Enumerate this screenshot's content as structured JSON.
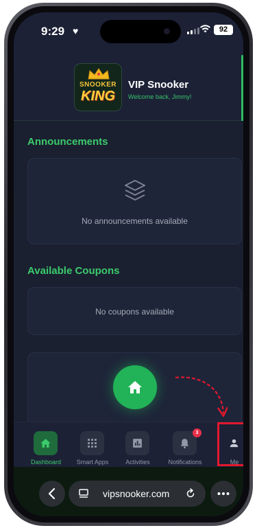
{
  "status_bar": {
    "time": "9:29",
    "battery": "92"
  },
  "header": {
    "logo_text_top": "SNOOKER",
    "logo_text_bottom": "KING",
    "title": "VIP Snooker",
    "welcome": "Welcome back, Jimmy!"
  },
  "announcements": {
    "title": "Announcements",
    "empty_message": "No announcements available"
  },
  "coupons": {
    "title": "Available Coupons",
    "empty_message": "No coupons available"
  },
  "tabs": [
    {
      "label": "Dashboard",
      "icon": "home-icon",
      "active": true
    },
    {
      "label": "Smart Apps",
      "icon": "grid-icon",
      "active": false
    },
    {
      "label": "Activities",
      "icon": "bar-chart-icon",
      "active": false
    },
    {
      "label": "Notifications",
      "icon": "bell-icon",
      "active": false,
      "badge": "3"
    },
    {
      "label": "Me",
      "icon": "user-icon",
      "active": false
    }
  ],
  "browser": {
    "url": "vipsnooker.com"
  },
  "colors": {
    "accent": "#3ccb6c",
    "highlight": "#e3182e",
    "background": "#1a2030"
  }
}
